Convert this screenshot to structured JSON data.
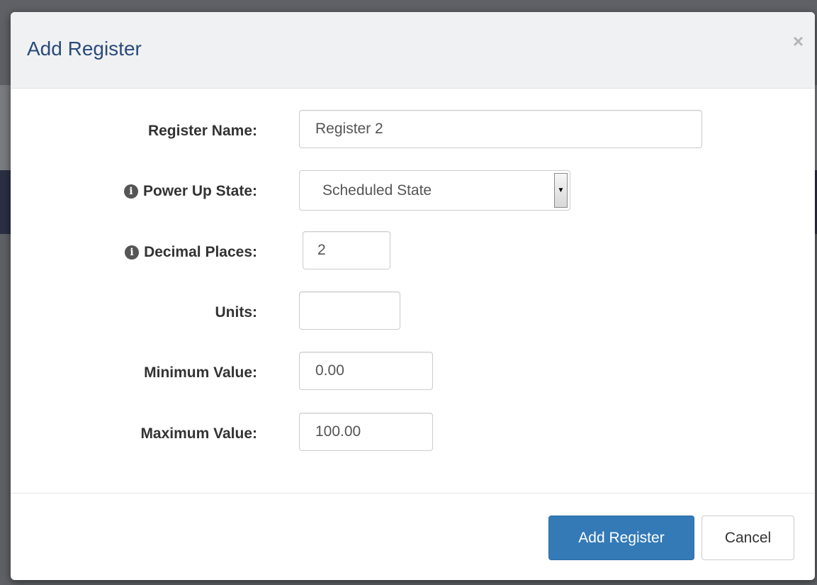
{
  "modal": {
    "title": "Add Register",
    "close_glyph": "×"
  },
  "form": {
    "register_name": {
      "label": "Register Name:",
      "value": "Register 2"
    },
    "power_up_state": {
      "label": "Power Up State:",
      "value": "Scheduled State",
      "info_icon": "info-circle-icon"
    },
    "decimal_places": {
      "label": "Decimal Places:",
      "value": "2",
      "info_icon": "info-circle-icon"
    },
    "units": {
      "label": "Units:",
      "value": ""
    },
    "minimum_value": {
      "label": "Minimum Value:",
      "value": "0.00"
    },
    "maximum_value": {
      "label": "Maximum Value:",
      "value": "100.00"
    }
  },
  "footer": {
    "add_label": "Add Register",
    "cancel_label": "Cancel"
  },
  "colors": {
    "primary": "#337ab7",
    "title": "#2a4a7a",
    "header_bg": "#f0f1f2"
  }
}
